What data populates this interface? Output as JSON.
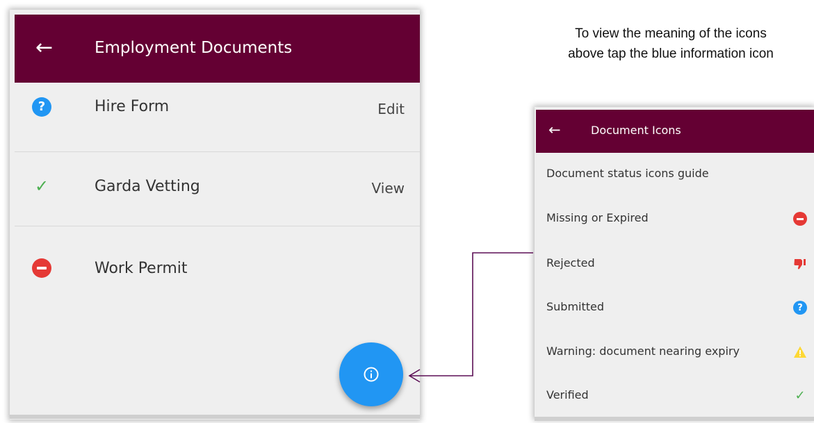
{
  "left_panel": {
    "header": {
      "back_icon": "arrow-left-icon",
      "title": "Employment Documents"
    },
    "rows": [
      {
        "icon": "question-icon",
        "label": "Hire Form",
        "action": "Edit"
      },
      {
        "icon": "check-icon",
        "label": "Garda Vetting",
        "action": "View"
      },
      {
        "icon": "minus-circle-icon",
        "label": "Work Permit",
        "action": ""
      }
    ],
    "fab_icon": "info-icon"
  },
  "caption": "To view the meaning of the icons above tap the blue information icon",
  "right_panel": {
    "header": {
      "back_icon": "arrow-left-icon",
      "title": "Document Icons"
    },
    "guide_title": "Document status icons guide",
    "items": [
      {
        "label": "Missing or Expired",
        "icon": "minus-circle-icon"
      },
      {
        "label": "Rejected",
        "icon": "thumbs-down-icon"
      },
      {
        "label": "Submitted",
        "icon": "question-icon"
      },
      {
        "label": "Warning: document nearing expiry",
        "icon": "warning-icon"
      },
      {
        "label": "Verified",
        "icon": "check-icon"
      }
    ]
  },
  "colors": {
    "header_bg": "#640033",
    "info_blue": "#2196f3",
    "error_red": "#e53935",
    "success_green": "#4caf50",
    "warning_yellow": "#fdd835",
    "connector": "#5c0f55"
  }
}
